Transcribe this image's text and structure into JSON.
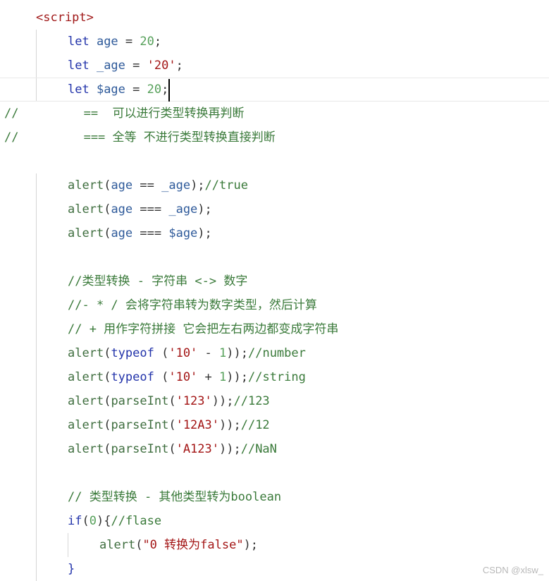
{
  "editor": {
    "lines": [
      {
        "indent": 1,
        "tokens": [
          {
            "t": "<script>",
            "c": "tag"
          }
        ]
      },
      {
        "indent": 2,
        "tokens": [
          {
            "t": "let",
            "c": "kw"
          },
          {
            "t": " age ",
            "c": "id"
          },
          {
            "t": "=",
            "c": "op"
          },
          {
            "t": " 20",
            "c": "num"
          },
          {
            "t": ";",
            "c": "op"
          }
        ]
      },
      {
        "indent": 2,
        "tokens": [
          {
            "t": "let",
            "c": "kw"
          },
          {
            "t": " _age ",
            "c": "id"
          },
          {
            "t": "=",
            "c": "op"
          },
          {
            "t": " '20'",
            "c": "str"
          },
          {
            "t": ";",
            "c": "op"
          }
        ]
      },
      {
        "indent": 2,
        "current": true,
        "caret": true,
        "tokens": [
          {
            "t": "let",
            "c": "kw"
          },
          {
            "t": " $age ",
            "c": "id"
          },
          {
            "t": "=",
            "c": "op"
          },
          {
            "t": " 20",
            "c": "num"
          },
          {
            "t": ";",
            "c": "op"
          }
        ]
      },
      {
        "indent": 0,
        "tokens": [
          {
            "t": "//         ==  可以进行类型转换再判断",
            "c": "cmtline"
          }
        ]
      },
      {
        "indent": 0,
        "tokens": [
          {
            "t": "//         === 全等 不进行类型转换直接判断",
            "c": "cmtline"
          }
        ]
      },
      {
        "indent": 0,
        "tokens": []
      },
      {
        "indent": 2,
        "tokens": [
          {
            "t": "alert",
            "c": "fn"
          },
          {
            "t": "(",
            "c": "op"
          },
          {
            "t": "age ",
            "c": "id"
          },
          {
            "t": "==",
            "c": "op"
          },
          {
            "t": " _age",
            "c": "id"
          },
          {
            "t": ");",
            "c": "op"
          },
          {
            "t": "//true",
            "c": "cmt"
          }
        ]
      },
      {
        "indent": 2,
        "tokens": [
          {
            "t": "alert",
            "c": "fn"
          },
          {
            "t": "(",
            "c": "op"
          },
          {
            "t": "age ",
            "c": "id"
          },
          {
            "t": "===",
            "c": "op"
          },
          {
            "t": " _age",
            "c": "id"
          },
          {
            "t": ");",
            "c": "op"
          }
        ]
      },
      {
        "indent": 2,
        "tokens": [
          {
            "t": "alert",
            "c": "fn"
          },
          {
            "t": "(",
            "c": "op"
          },
          {
            "t": "age ",
            "c": "id"
          },
          {
            "t": "===",
            "c": "op"
          },
          {
            "t": " $age",
            "c": "id"
          },
          {
            "t": ");",
            "c": "op"
          }
        ]
      },
      {
        "indent": 0,
        "tokens": []
      },
      {
        "indent": 2,
        "tokens": [
          {
            "t": "//类型转换 - 字符串 <-> 数字",
            "c": "cmt"
          }
        ]
      },
      {
        "indent": 2,
        "tokens": [
          {
            "t": "//- * / 会将字符串转为数字类型，然后计算",
            "c": "cmt"
          }
        ]
      },
      {
        "indent": 2,
        "tokens": [
          {
            "t": "// + 用作字符拼接 它会把左右两边都变成字符串",
            "c": "cmt"
          }
        ]
      },
      {
        "indent": 2,
        "tokens": [
          {
            "t": "alert",
            "c": "fn"
          },
          {
            "t": "(",
            "c": "op"
          },
          {
            "t": "typeof",
            "c": "kw"
          },
          {
            "t": " (",
            "c": "op"
          },
          {
            "t": "'10'",
            "c": "str"
          },
          {
            "t": " - ",
            "c": "op"
          },
          {
            "t": "1",
            "c": "num"
          },
          {
            "t": "));",
            "c": "op"
          },
          {
            "t": "//number",
            "c": "cmt"
          }
        ]
      },
      {
        "indent": 2,
        "tokens": [
          {
            "t": "alert",
            "c": "fn"
          },
          {
            "t": "(",
            "c": "op"
          },
          {
            "t": "typeof",
            "c": "kw"
          },
          {
            "t": " (",
            "c": "op"
          },
          {
            "t": "'10'",
            "c": "str"
          },
          {
            "t": " + ",
            "c": "op"
          },
          {
            "t": "1",
            "c": "num"
          },
          {
            "t": "));",
            "c": "op"
          },
          {
            "t": "//string",
            "c": "cmt"
          }
        ]
      },
      {
        "indent": 2,
        "tokens": [
          {
            "t": "alert",
            "c": "fn"
          },
          {
            "t": "(",
            "c": "op"
          },
          {
            "t": "parseInt",
            "c": "fn"
          },
          {
            "t": "(",
            "c": "op"
          },
          {
            "t": "'123'",
            "c": "str"
          },
          {
            "t": "));",
            "c": "op"
          },
          {
            "t": "//123",
            "c": "cmt"
          }
        ]
      },
      {
        "indent": 2,
        "tokens": [
          {
            "t": "alert",
            "c": "fn"
          },
          {
            "t": "(",
            "c": "op"
          },
          {
            "t": "parseInt",
            "c": "fn"
          },
          {
            "t": "(",
            "c": "op"
          },
          {
            "t": "'12A3'",
            "c": "str"
          },
          {
            "t": "));",
            "c": "op"
          },
          {
            "t": "//12",
            "c": "cmt"
          }
        ]
      },
      {
        "indent": 2,
        "tokens": [
          {
            "t": "alert",
            "c": "fn"
          },
          {
            "t": "(",
            "c": "op"
          },
          {
            "t": "parseInt",
            "c": "fn"
          },
          {
            "t": "(",
            "c": "op"
          },
          {
            "t": "'A123'",
            "c": "str"
          },
          {
            "t": "));",
            "c": "op"
          },
          {
            "t": "//NaN",
            "c": "cmt"
          }
        ]
      },
      {
        "indent": 0,
        "tokens": []
      },
      {
        "indent": 2,
        "tokens": [
          {
            "t": "// 类型转换 - 其他类型转为boolean",
            "c": "cmt"
          }
        ]
      },
      {
        "indent": 2,
        "tokens": [
          {
            "t": "if",
            "c": "kw"
          },
          {
            "t": "(",
            "c": "op"
          },
          {
            "t": "0",
            "c": "num"
          },
          {
            "t": "){",
            "c": "op"
          },
          {
            "t": "//flase",
            "c": "cmt"
          }
        ]
      },
      {
        "indent": 3,
        "tokens": [
          {
            "t": "alert",
            "c": "fn"
          },
          {
            "t": "(",
            "c": "op"
          },
          {
            "t": "\"0 转换为false\"",
            "c": "str"
          },
          {
            "t": ");",
            "c": "op"
          }
        ]
      },
      {
        "indent": 2,
        "tokens": [
          {
            "t": "}",
            "c": "kw"
          }
        ]
      }
    ]
  },
  "watermark": "CSDN @xlsw_"
}
